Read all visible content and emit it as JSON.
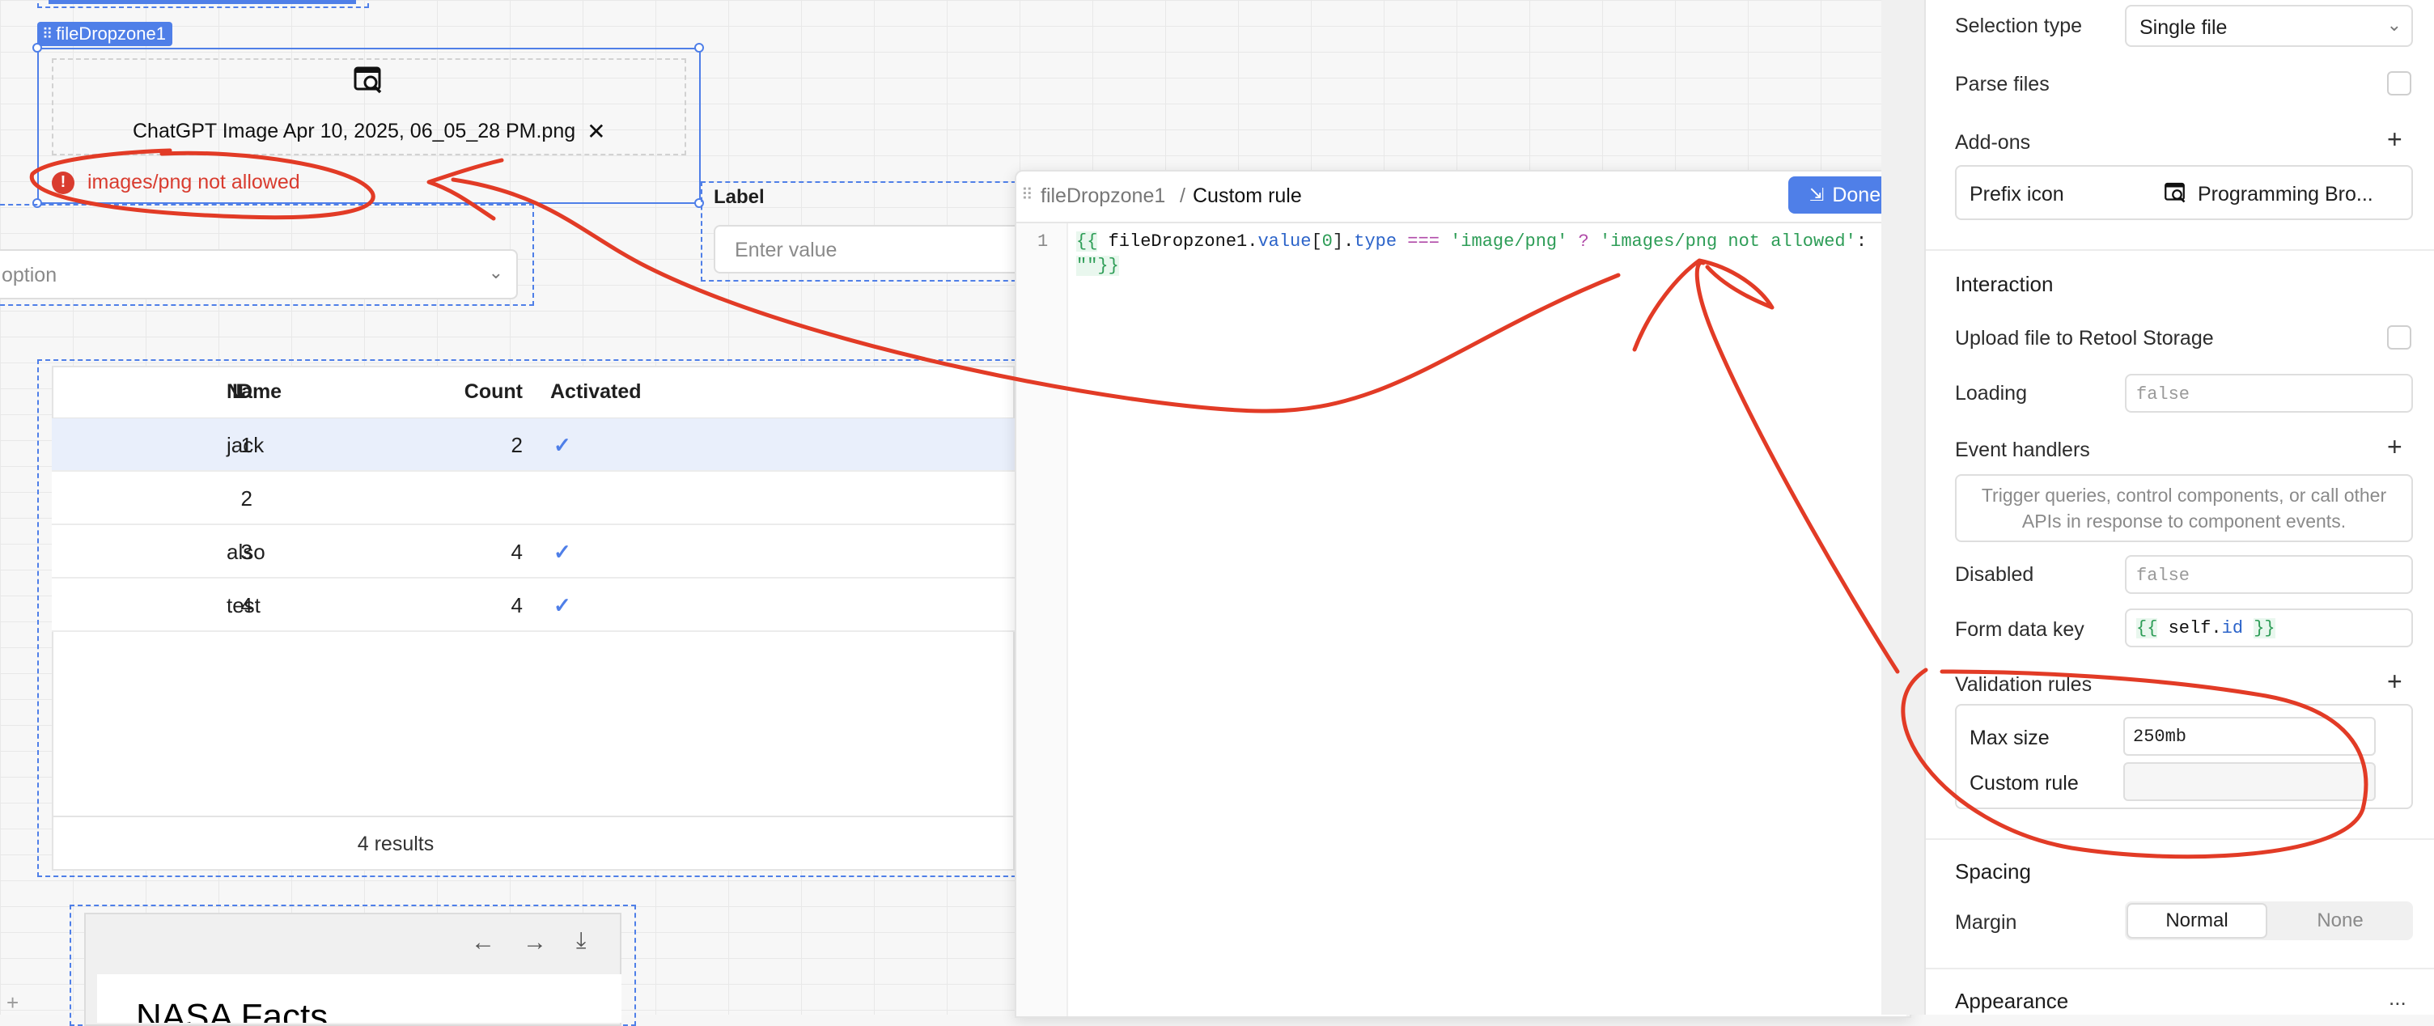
{
  "canvas": {
    "component_tag": "fileDropzone1",
    "file_name": "ChatGPT Image Apr 10, 2025, 06_05_28 PM.png",
    "error_message": "images/png not allowed",
    "label_text": "Label",
    "input_placeholder": "Enter value",
    "select_placeholder": "option",
    "table": {
      "columns": [
        "ID",
        "Name",
        "Count",
        "Activated"
      ],
      "rows": [
        {
          "id": "1",
          "name": "jack",
          "count": "2",
          "activated": true
        },
        {
          "id": "2",
          "name": "",
          "count": "",
          "activated": false
        },
        {
          "id": "3",
          "name": "also",
          "count": "4",
          "activated": true
        },
        {
          "id": "4",
          "name": "test",
          "count": "4",
          "activated": true
        }
      ],
      "footer": "4 results"
    },
    "browser_title": "NASA Facts"
  },
  "editor": {
    "breadcrumb_parent": "fileDropzone1",
    "breadcrumb_sep": "/",
    "breadcrumb_current": "Custom rule",
    "done_label": "Done",
    "line_number": "1",
    "code": {
      "open": "{{",
      "ident": "fileDropzone1",
      "dot1": ".",
      "prop_value": "value",
      "bracket_open": "[",
      "index": "0",
      "bracket_close": "]",
      "dot2": ".",
      "prop_type": "type",
      "op": "===",
      "str1": "'image/png'",
      "q": "?",
      "str2": "'images/png not allowed'",
      "colon": ":",
      "line2": "\"\"}}"
    }
  },
  "panel": {
    "selection_type_label": "Selection type",
    "selection_type_value": "Single file",
    "parse_files_label": "Parse files",
    "addons_label": "Add-ons",
    "prefix_icon_label": "Prefix icon",
    "prefix_icon_value": "Programming Bro...",
    "interaction_header": "Interaction",
    "upload_label": "Upload file to Retool Storage",
    "loading_label": "Loading",
    "loading_value": "false",
    "event_handlers_label": "Event handlers",
    "event_handlers_hint": "Trigger queries, control components, or call other APIs in response to component events.",
    "disabled_label": "Disabled",
    "disabled_value": "false",
    "form_data_key_label": "Form data key",
    "form_data_key_value": {
      "open": "{{",
      "self": "self",
      "dot": ".",
      "id": "id",
      "close": "}}"
    },
    "validation_rules_label": "Validation rules",
    "max_size_label": "Max size",
    "max_size_value": "250mb",
    "custom_rule_label": "Custom rule",
    "spacing_header": "Spacing",
    "margin_label": "Margin",
    "margin_normal": "Normal",
    "margin_none": "None",
    "appearance_header": "Appearance",
    "more_icon": "..."
  },
  "colors": {
    "accent": "#4f7fe8",
    "error": "#d93c2f",
    "annotation": "#e23b26",
    "code_green": "#2e9d57",
    "code_string_bg": "#e9f7ee"
  }
}
